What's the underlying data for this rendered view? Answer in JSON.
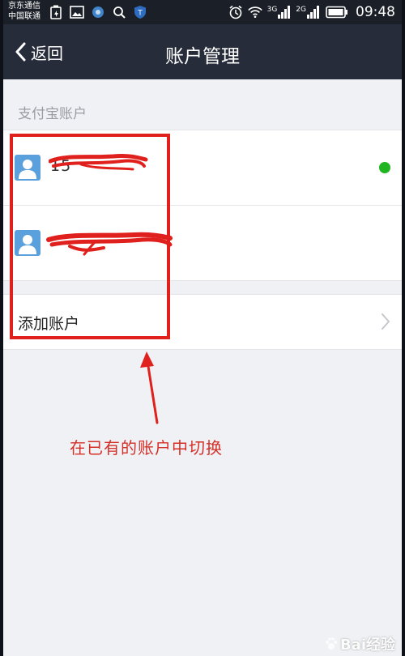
{
  "status_bar": {
    "carrier_1": "京东通信",
    "carrier_2": "中国联通",
    "network_1": "3G",
    "network_2": "2G",
    "time": "09:48"
  },
  "nav": {
    "back_label": "返回",
    "title": "账户管理"
  },
  "section": {
    "header": "支付宝账户"
  },
  "accounts": [
    {
      "name": "15",
      "active": true
    },
    {
      "name": "",
      "active": false
    }
  ],
  "add_account": {
    "label": "添加账户"
  },
  "annotation": {
    "text": "在已有的账户中切换",
    "color": "#d23028"
  },
  "watermark": {
    "text": "Bai经验"
  },
  "colors": {
    "nav_bg": "#262c3a",
    "status_bg": "#1b1f27",
    "page_bg": "#f0f1f5",
    "active_dot": "#22b523",
    "avatar_bg": "#5aa0dc",
    "highlight": "#e0201c"
  }
}
